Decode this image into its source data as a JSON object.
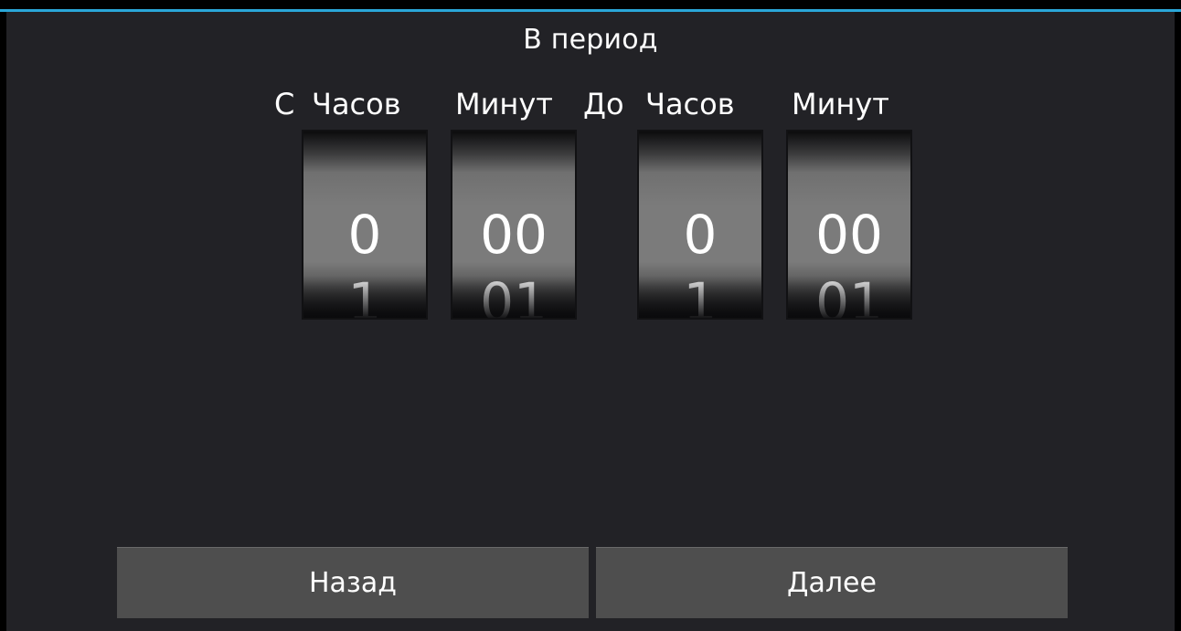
{
  "title": "В период",
  "labels": {
    "from": "С",
    "from_hours": "Часов",
    "from_minutes": "Минут",
    "to": "До",
    "to_hours": "Часов",
    "to_minutes": "Минут"
  },
  "pickers": {
    "from_hours": {
      "current": "0",
      "next": "1"
    },
    "from_minutes": {
      "current": "00",
      "next": "01"
    },
    "to_hours": {
      "current": "0",
      "next": "1"
    },
    "to_minutes": {
      "current": "00",
      "next": "01"
    }
  },
  "buttons": {
    "back": "Назад",
    "next": "Далее"
  },
  "colors": {
    "accent": "#2aa7d8",
    "background": "#222226",
    "button": "#4e4e4e"
  }
}
